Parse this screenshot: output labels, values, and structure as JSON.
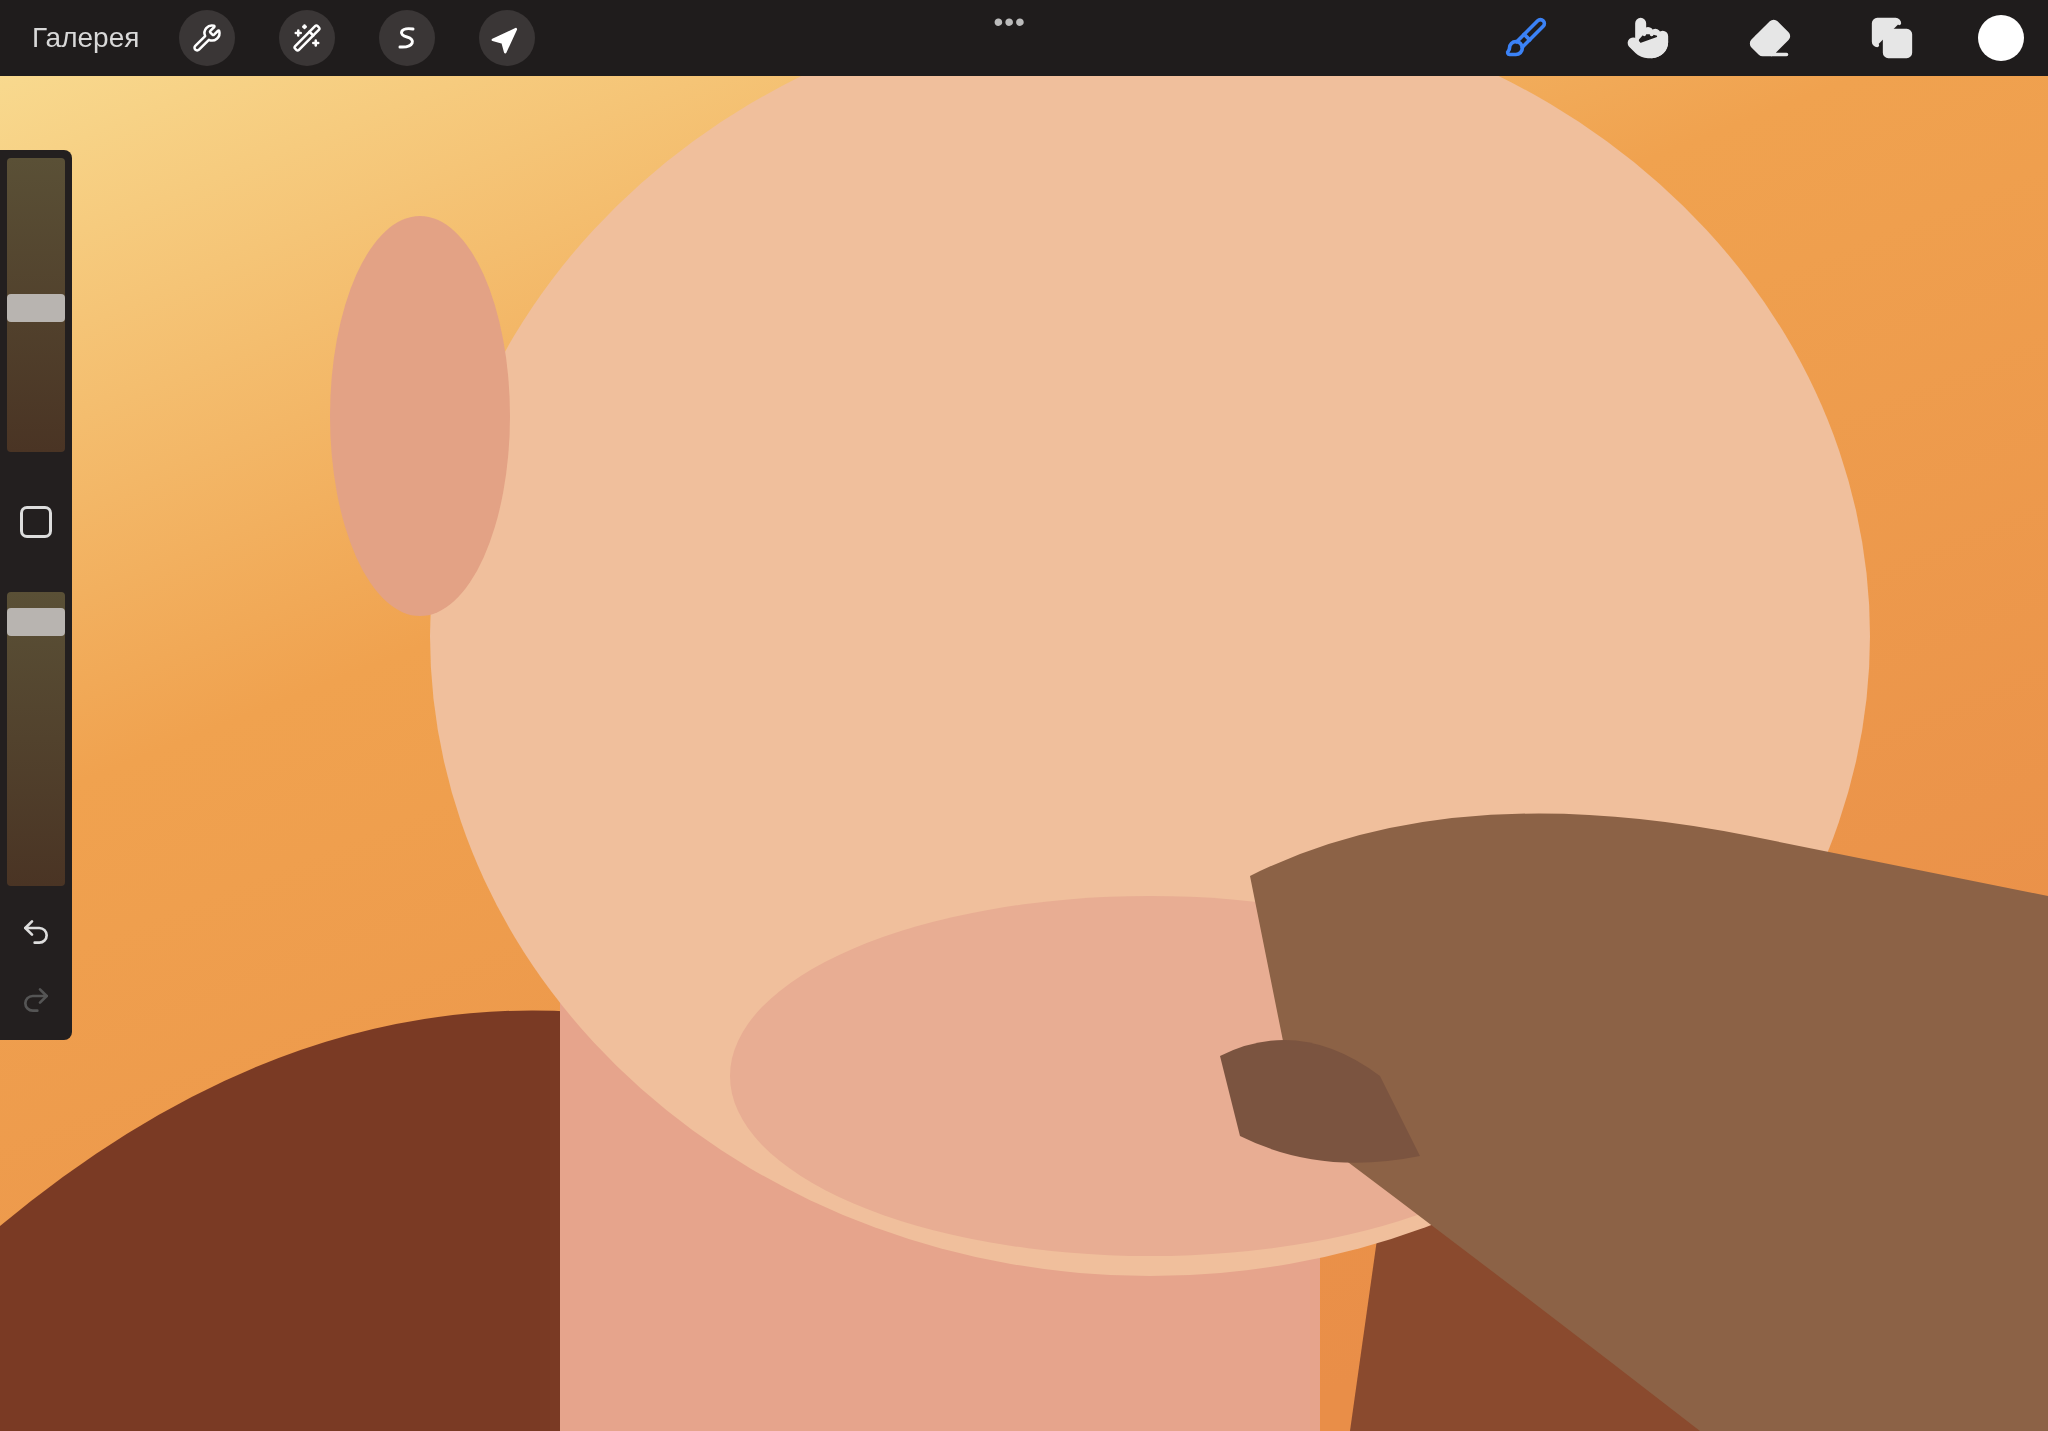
{
  "toolbar": {
    "gallery": "Галерея",
    "menu": "•••",
    "left_tools": [
      {
        "kind": "wrench"
      },
      {
        "kind": "wand"
      },
      {
        "kind": "selection"
      },
      {
        "kind": "transform"
      }
    ],
    "right_tools": [
      {
        "kind": "brush",
        "selected": true
      },
      {
        "kind": "smudge",
        "selected": false
      },
      {
        "kind": "eraser",
        "selected": false
      },
      {
        "kind": "layers",
        "selected": false
      }
    ]
  },
  "sidebar": {
    "size_slider": {
      "level": 0.49
    },
    "opacity_slider": {
      "level": 0.94
    },
    "undo": {
      "disabled": false
    },
    "redo": {
      "disabled": true
    }
  }
}
